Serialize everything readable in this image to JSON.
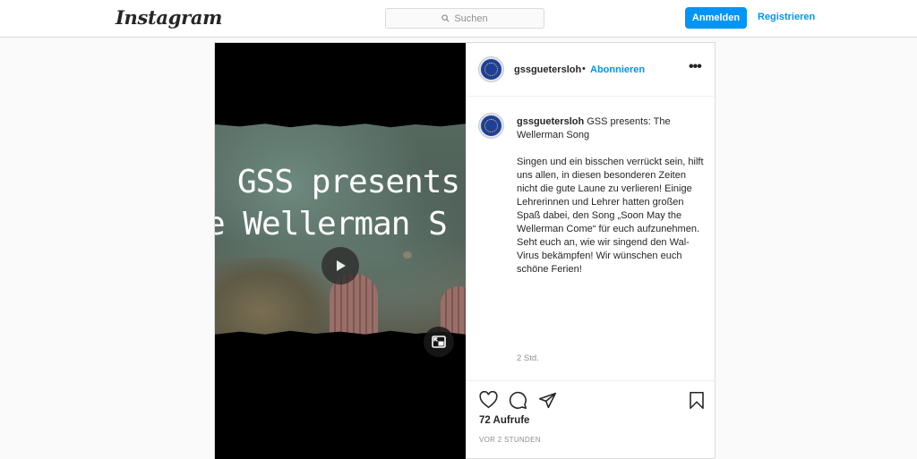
{
  "topbar": {
    "logo": "Instagram",
    "search_placeholder": "Suchen",
    "login_label": "Anmelden",
    "register_label": "Registrieren"
  },
  "post": {
    "username": "gssguetersloh",
    "separator": "•",
    "follow_label": "Abonnieren",
    "more_label": "•••",
    "video": {
      "title_line1": "GSS presents",
      "title_line2": "e Wellerman S"
    },
    "caption": {
      "username": "gssguetersloh",
      "title": " GSS presents: The Wellerman Song",
      "body": "Singen und ein bisschen verrückt sein, hilft uns allen, in diesen besonderen Zeiten nicht die gute Laune zu verlieren! Einige Lehrerinnen und Lehrer hatten großen Spaß dabei, den Song „Soon May the Wellerman Come“ für euch aufzunehmen. Seht euch an, wie wir singend den Wal-Virus bekämpfen! Wir wünschen euch schöne Ferien!",
      "age": "2 Std."
    },
    "views": "72 Aufrufe",
    "timestamp": "VOR 2 STUNDEN"
  },
  "colors": {
    "accent": "#0095f6",
    "avatar_blue": "#1f3f97",
    "border": "#dbdbdb"
  },
  "icons": [
    "search-icon",
    "play-icon",
    "pip-icon",
    "heart-icon",
    "comment-icon",
    "share-icon",
    "bookmark-icon"
  ]
}
